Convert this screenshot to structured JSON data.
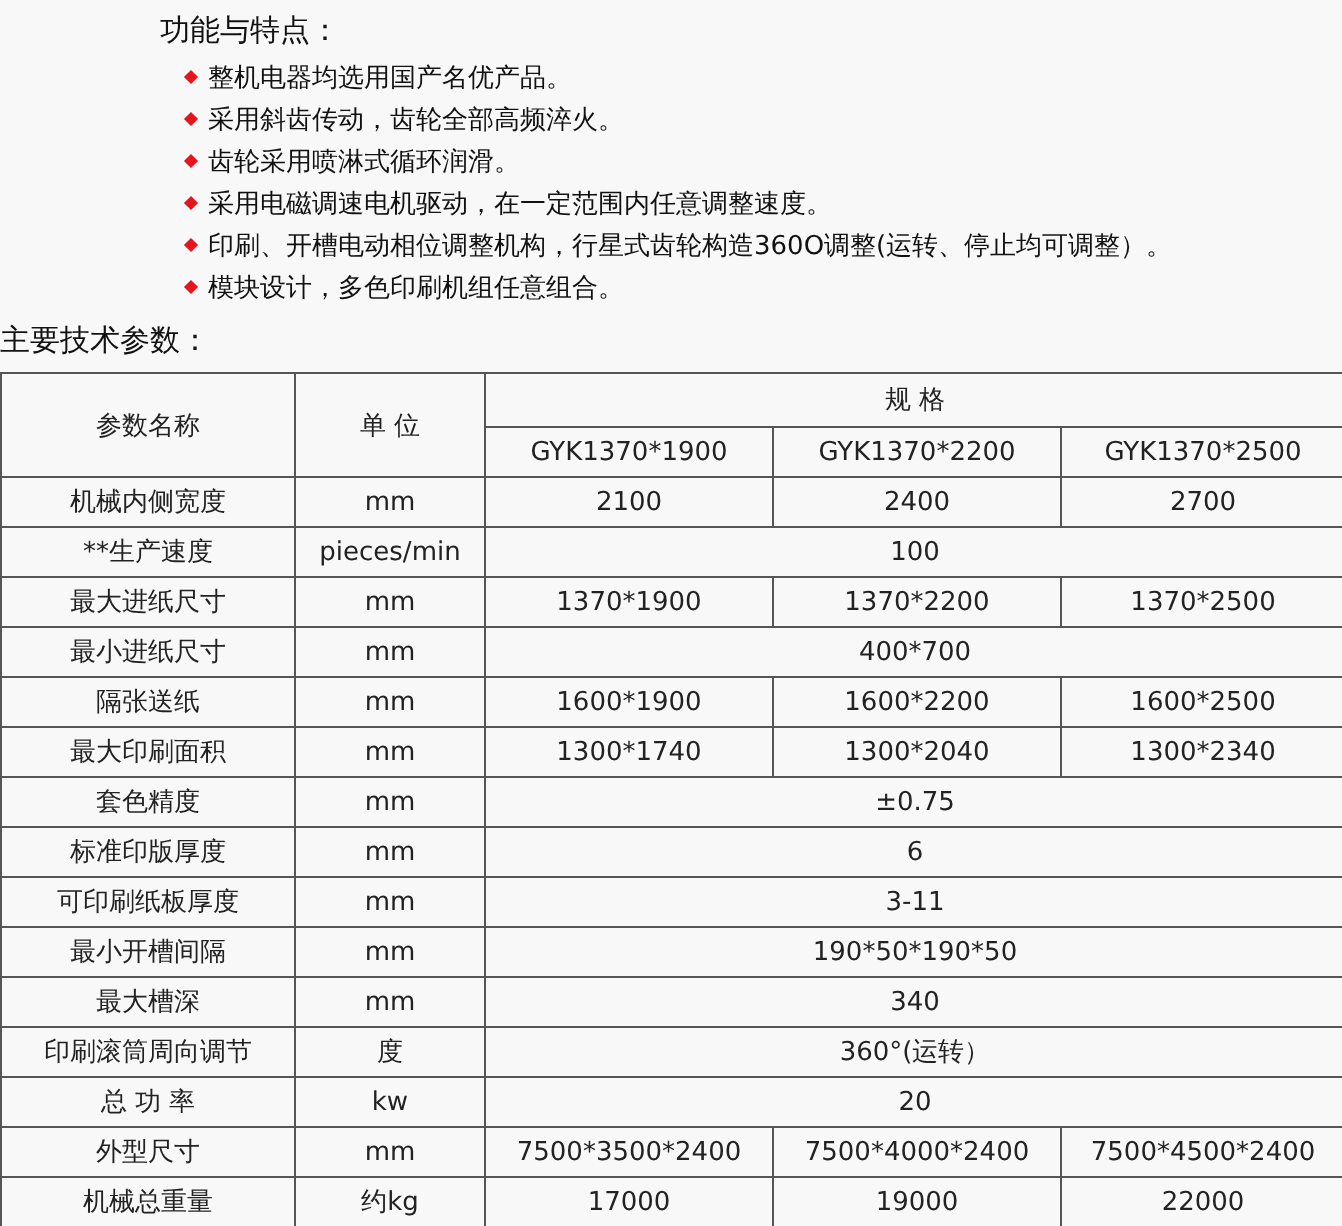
{
  "features": {
    "title": "功能与特点：",
    "items": [
      "整机电器均选用国产名优产品。",
      "采用斜齿传动，齿轮全部高频淬火。",
      "齿轮采用喷淋式循环润滑。",
      "采用电磁调速电机驱动，在一定范围内任意调整速度。",
      "印刷、开槽电动相位调整机构，行星式齿轮构造360O调整(运转、停止均可调整）。",
      "模块设计，多色印刷机组任意组合。"
    ]
  },
  "specs": {
    "title": "主要技术参数：",
    "table": {
      "columns": [
        "参数名称",
        "单 位",
        "规 格"
      ],
      "models": [
        "GYK1370*1900",
        "GYK1370*2200",
        "GYK1370*2500"
      ],
      "rows": [
        {
          "name": "机械内侧宽度",
          "unit": "mm",
          "values": [
            "2100",
            "2400",
            "2700"
          ]
        },
        {
          "name": "**生产速度",
          "unit": "pieces/min",
          "values": [
            "100"
          ]
        },
        {
          "name": "最大进纸尺寸",
          "unit": "mm",
          "values": [
            "1370*1900",
            "1370*2200",
            "1370*2500"
          ]
        },
        {
          "name": "最小进纸尺寸",
          "unit": "mm",
          "values": [
            "400*700"
          ]
        },
        {
          "name": "隔张送纸",
          "unit": "mm",
          "values": [
            "1600*1900",
            "1600*2200",
            "1600*2500"
          ]
        },
        {
          "name": "最大印刷面积",
          "unit": "mm",
          "values": [
            "1300*1740",
            "1300*2040",
            "1300*2340"
          ]
        },
        {
          "name": "套色精度",
          "unit": "mm",
          "values": [
            "±0.75"
          ]
        },
        {
          "name": "标准印版厚度",
          "unit": "mm",
          "values": [
            "6"
          ]
        },
        {
          "name": "可印刷纸板厚度",
          "unit": "mm",
          "values": [
            "3-11"
          ]
        },
        {
          "name": "最小开槽间隔",
          "unit": "mm",
          "values": [
            "190*50*190*50"
          ]
        },
        {
          "name": "最大槽深",
          "unit": "mm",
          "values": [
            "340"
          ]
        },
        {
          "name": "印刷滚筒周向调节",
          "unit": "度",
          "values": [
            "360°(运转）"
          ]
        },
        {
          "name": "总 功 率",
          "unit": "kw",
          "values": [
            "20"
          ]
        },
        {
          "name": "外型尺寸",
          "unit": "mm",
          "values": [
            "7500*3500*2400",
            "7500*4000*2400",
            "7500*4500*2400"
          ]
        },
        {
          "name": "机械总重量",
          "unit": "约kg",
          "values": [
            "17000",
            "19000",
            "22000"
          ]
        }
      ]
    }
  }
}
